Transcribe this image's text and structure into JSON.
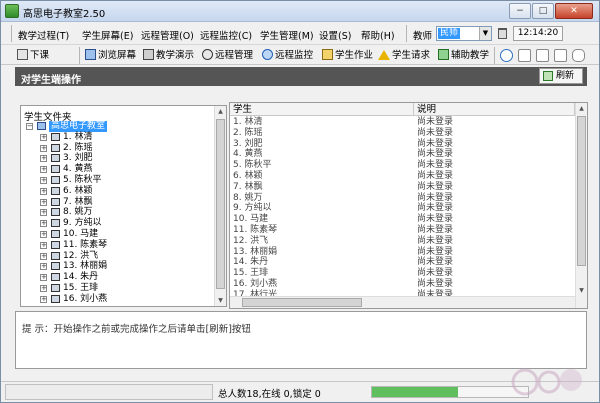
{
  "window": {
    "title": "高思电子教室2.50"
  },
  "window_controls": {
    "minimize": "−",
    "maximize": "□",
    "close": "✕"
  },
  "menu": [
    "教学过程(T)",
    "学生屏幕(E)",
    "远程管理(O)",
    "远程监控(C)",
    "学生管理(M)",
    "设置(S)",
    "帮助(H)"
  ],
  "teacher": {
    "label": "教师",
    "selected": "民师"
  },
  "clock": "12:14:20",
  "toolbar": [
    "下课",
    "浏览屏幕",
    "教学演示",
    "远程管理",
    "远程监控",
    "学生作业",
    "学生请求",
    "辅助教学"
  ],
  "toolbar_small_icons": [
    "chat-icon",
    "abc-icon",
    "grid-icon",
    "fullscreen-icon",
    "hand-icon"
  ],
  "section": {
    "title": "对学生端操作",
    "refresh": "刷新"
  },
  "left_panel": {
    "header": "学生文件夹",
    "root": "高思电子教室",
    "students": [
      "1. 林清",
      "2. 陈瑶",
      "3. 刘肥",
      "4. 黄燕",
      "5. 陈秋平",
      "6. 林颖",
      "7. 林飘",
      "8. 姚万",
      "9. 方纯以",
      "10. 马建",
      "11. 陈素琴",
      "12. 洪飞",
      "13. 林丽娟",
      "14. 朱丹",
      "15. 王琲",
      "16. 刘小燕"
    ]
  },
  "right_panel": {
    "columns": [
      "学生",
      "说明"
    ],
    "rows": [
      {
        "student": "1. 林清",
        "note": "尚未登录"
      },
      {
        "student": "2. 陈瑶",
        "note": "尚未登录"
      },
      {
        "student": "3. 刘肥",
        "note": "尚未登录"
      },
      {
        "student": "4. 黄燕",
        "note": "尚未登录"
      },
      {
        "student": "5. 陈秋平",
        "note": "尚未登录"
      },
      {
        "student": "6. 林颖",
        "note": "尚未登录"
      },
      {
        "student": "7. 林飘",
        "note": "尚未登录"
      },
      {
        "student": "8. 姚万",
        "note": "尚未登录"
      },
      {
        "student": "9. 方纯以",
        "note": "尚未登录"
      },
      {
        "student": "10. 马建",
        "note": "尚未登录"
      },
      {
        "student": "11. 陈素琴",
        "note": "尚未登录"
      },
      {
        "student": "12. 洪飞",
        "note": "尚未登录"
      },
      {
        "student": "13. 林丽娟",
        "note": "尚未登录"
      },
      {
        "student": "14. 朱丹",
        "note": "尚未登录"
      },
      {
        "student": "15. 王琲",
        "note": "尚未登录"
      },
      {
        "student": "16. 刘小燕",
        "note": "尚未登录"
      },
      {
        "student": "17. 林行光",
        "note": "尚未登录"
      }
    ]
  },
  "hint": "提    示：开始操作之前或完成操作之后请单击[刷新]按钮",
  "status": {
    "text": "总人数18,在线 0,锁定 0",
    "progress": 0.55
  },
  "colors": {
    "selection": "#3399ff",
    "section_bar": "#555555",
    "progress": "#5fbf5f"
  }
}
